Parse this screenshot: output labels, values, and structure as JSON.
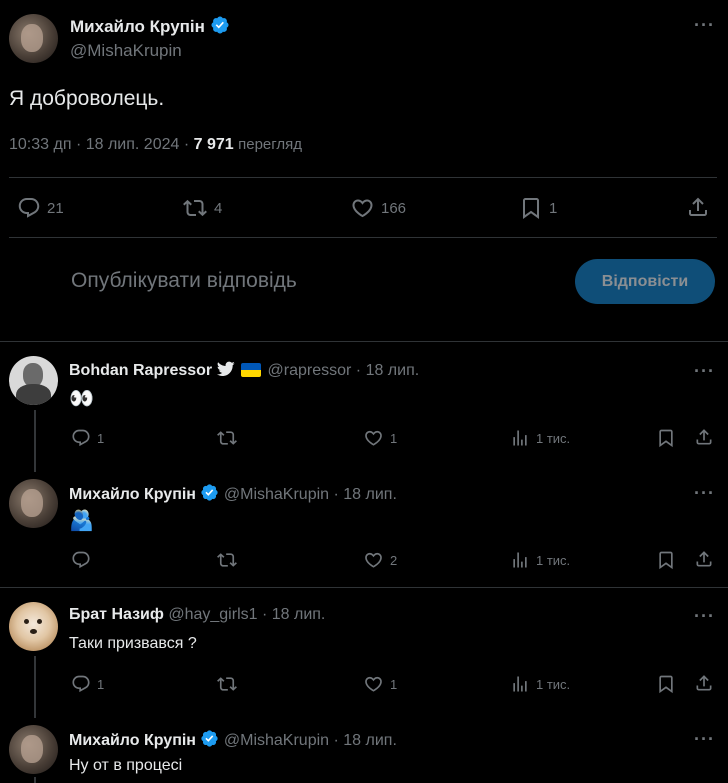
{
  "main_tweet": {
    "author_name": "Михайло Крупін",
    "handle": "@MishaKrupin",
    "text": "Я доброволець.",
    "time": "10:33 дп",
    "date": "18 лип. 2024",
    "views_count": "7 971",
    "views_label": "перегляд",
    "replies": "21",
    "retweets": "4",
    "likes": "166",
    "bookmarks": "1"
  },
  "composer": {
    "placeholder": "Опублікувати відповідь",
    "button_label": "Відповісти",
    "button_color": "#1d9bf0"
  },
  "replies": [
    {
      "author_name": "Bohdan Rapressor",
      "handle": "@rapressor",
      "date": "18 лип.",
      "text": "👀",
      "replies": "1",
      "retweets": "",
      "likes": "1",
      "views": "1 тис."
    },
    {
      "author_name": "Михайло Крупін",
      "handle": "@MishaKrupin",
      "date": "18 лип.",
      "text": "🫂",
      "replies": "",
      "retweets": "",
      "likes": "2",
      "views": "1 тис."
    },
    {
      "author_name": "Брат Назиф",
      "handle": "@hay_girls1",
      "date": "18 лип.",
      "text": "Таки призвався ?",
      "replies": "1",
      "retweets": "",
      "likes": "1",
      "views": "1 тис."
    },
    {
      "author_name": "Михайло Крупін",
      "handle": "@MishaKrupin",
      "date": "18 лип.",
      "text": "Ну от в процесі"
    }
  ],
  "separator": "·",
  "colors": {
    "background": "#000000",
    "text": "#e7e9ea",
    "muted": "#71767b",
    "verified": "#1d9bf0",
    "divider": "#2f3336"
  },
  "icons": {
    "reply": "reply-icon",
    "retweet": "retweet-icon",
    "like": "heart-icon",
    "bookmark": "bookmark-icon",
    "share": "share-icon",
    "views": "views-icon",
    "more": "more-icon",
    "verified": "verified-badge-icon"
  }
}
